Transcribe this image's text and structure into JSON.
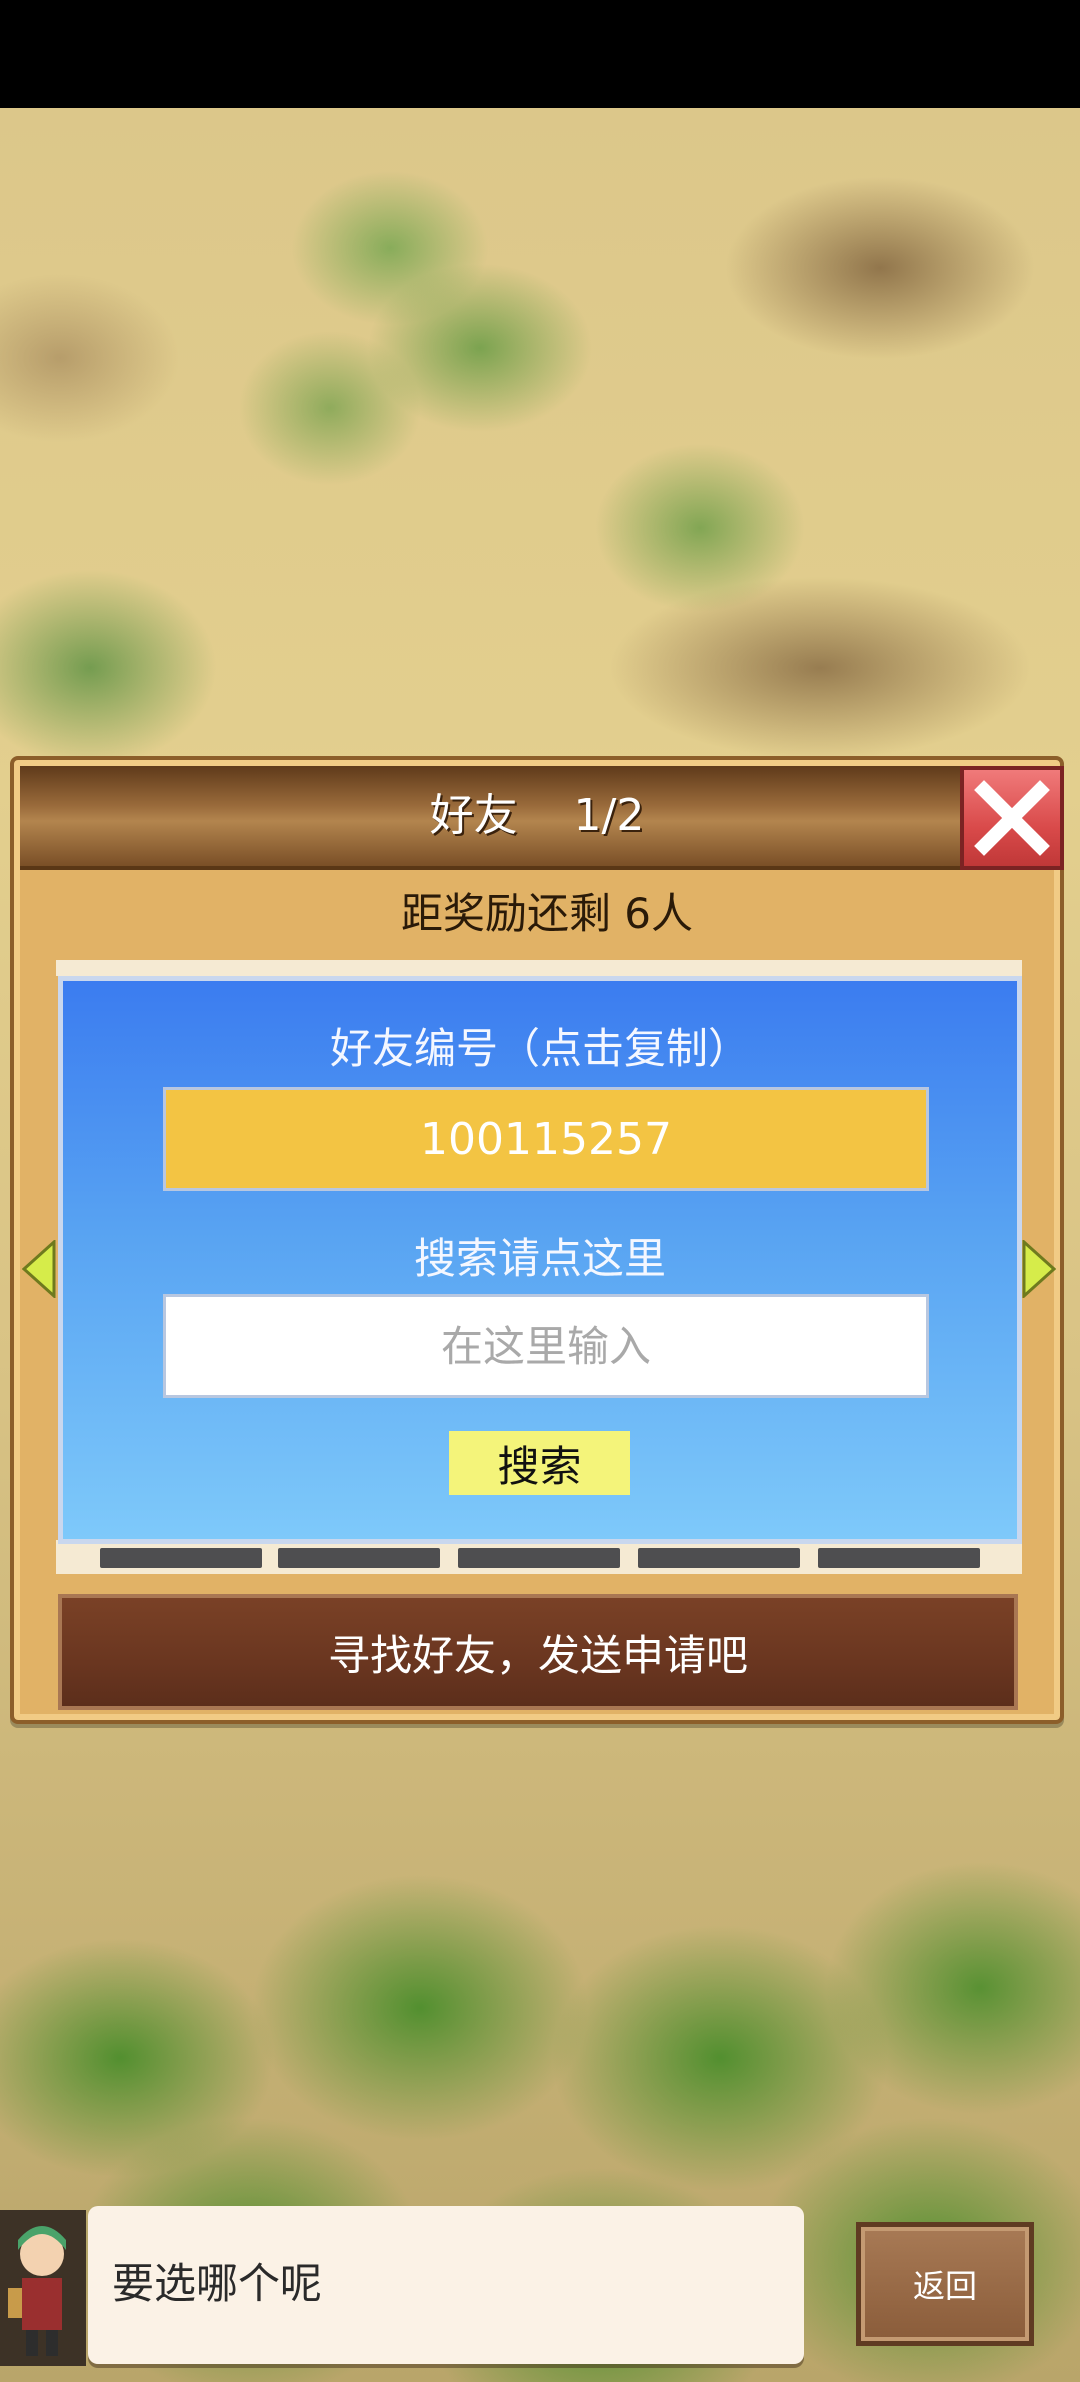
{
  "dialog": {
    "title": "好友    1/2",
    "reward_text": "距奖励还剩 6人"
  },
  "friend_panel": {
    "id_label": "好友编号（点击复制）",
    "friend_id": "100115257",
    "search_label": "搜索请点这里",
    "search_placeholder": "在这里输入",
    "search_button": "搜索"
  },
  "hint": "寻找好友，发送申请吧",
  "speech": "要选哪个呢",
  "back_button": "返回",
  "colors": {
    "panel_blue": "#3b7cf0",
    "id_box": "#f3c443",
    "search_button": "#f4f47a",
    "close_button": "#d94a4a"
  },
  "icons": {
    "close": "close-icon",
    "prev": "arrow-left-icon",
    "next": "arrow-right-icon"
  }
}
